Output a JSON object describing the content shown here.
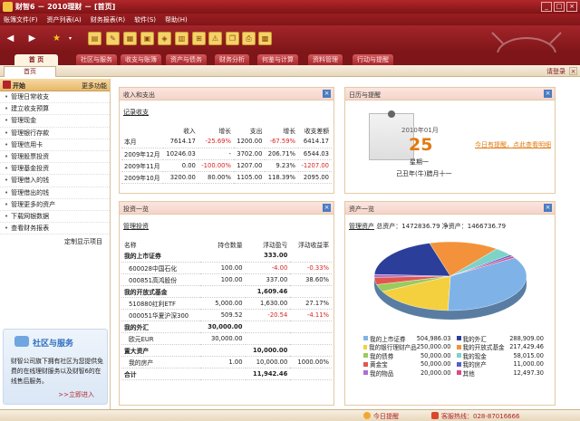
{
  "window": {
    "title": "财智6 － 2010理财 － [首页]",
    "buttons": [
      "_",
      "□",
      "×"
    ]
  },
  "menu": [
    "账簿文件(F)",
    "资产列表(A)",
    "财务报表(R)",
    "软件(S)",
    "帮助(H)"
  ],
  "tabs": [
    "首 页",
    "社区与服务",
    "收支与账簿",
    "资产与债务",
    "财务分析",
    "何鉴与计算",
    "资料管理",
    "行动与提醒"
  ],
  "subbar": {
    "tab": "首页",
    "right": "请登录",
    "close": "×"
  },
  "sidebar": {
    "head": "开始",
    "more": "更多功能",
    "items": [
      "管理日常收支",
      "建立收支预算",
      "管理现金",
      "管理银行存款",
      "管理信用卡",
      "管理股票投资",
      "管理基金投资",
      "管理借入的钱",
      "管理借出的钱",
      "管理更多的资产",
      "下载网银数据",
      "查看财务报表"
    ],
    "custom": "定制显示项目",
    "community": {
      "title": "社区与服务",
      "text": "财智公司旗下拥有社区为您提供免费的在线理财服务以及财智6的在线售后服务。",
      "link": ">>立即进入"
    }
  },
  "income": {
    "title": "收入和支出",
    "subtitle": "记录收支",
    "headers": [
      "",
      "收入",
      "增长",
      "支出",
      "增长",
      "收支差额"
    ],
    "rows": [
      [
        "本月",
        "7614.17",
        "-25.69%",
        "1200.00",
        "-67.59%",
        "6414.17"
      ],
      [
        "2009年12月",
        "10246.03",
        "-",
        "3702.00",
        "206.71%",
        "6544.03"
      ],
      [
        "2009年11月",
        "0.00",
        "-100.00%",
        "1207.00",
        "9.23%",
        "-1207.00"
      ],
      [
        "2009年10月",
        "3200.00",
        "80.00%",
        "1105.00",
        "118.39%",
        "2095.00"
      ]
    ]
  },
  "invest": {
    "title": "投资一览",
    "subtitle": "管理投资",
    "headers": [
      "名称",
      "持仓数量",
      "浮动盈亏",
      "浮动收益率"
    ],
    "rows": [
      {
        "name": "我的上市证券",
        "qty": "",
        "pl": "333.00",
        "rate": "",
        "group": true
      },
      {
        "name": "600028中国石化",
        "qty": "100.00",
        "pl": "-4.00",
        "rate": "-0.33%",
        "group": false
      },
      {
        "name": "000851高鸿股份",
        "qty": "100.00",
        "pl": "337.00",
        "rate": "38.60%",
        "group": false
      },
      {
        "name": "我的开放式基金",
        "qty": "",
        "pl": "1,609.46",
        "rate": "",
        "group": true
      },
      {
        "name": "510880红利ETF",
        "qty": "5,000.00",
        "pl": "1,630.00",
        "rate": "27.17%",
        "group": false
      },
      {
        "name": "000051华夏沪深300",
        "qty": "509.52",
        "pl": "-20.54",
        "rate": "-4.11%",
        "group": false
      },
      {
        "name": "我的外汇",
        "qty": "30,000.00",
        "pl": "",
        "rate": "",
        "group": true
      },
      {
        "name": "欧元EUR",
        "qty": "30,000.00",
        "pl": "",
        "rate": "",
        "group": false
      },
      {
        "name": "置大资产",
        "qty": "",
        "pl": "10,000.00",
        "rate": "",
        "group": true
      },
      {
        "name": "我的房产",
        "qty": "1.00",
        "pl": "10,000.00",
        "rate": "1000.00%",
        "group": false
      },
      {
        "name": "合计",
        "qty": "",
        "pl": "11,942.46",
        "rate": "",
        "group": true
      }
    ]
  },
  "calendar": {
    "title": "日历与提醒",
    "date": "2010年01月",
    "day": "25",
    "weekday": "星期一",
    "lunar": "己丑年(牛)腊月十一",
    "link": "今日有提醒，点此查看明细"
  },
  "assets": {
    "title": "资产一览",
    "subtitle": "管理资产",
    "summary": "总资产：1472836.79 净资产：1466736.79"
  },
  "chart_data": {
    "type": "pie",
    "categories": [
      "我的上市证券",
      "我的银行理财产品",
      "我的债券",
      "黄金宝",
      "我的物品",
      "我的外汇",
      "我的开放式基金",
      "我的现金",
      "我的房产",
      "其他"
    ],
    "values": [
      504986.03,
      250000.0,
      50000.0,
      50000.0,
      20000.0,
      288909.0,
      217429.46,
      58015.0,
      11000.0,
      12497.3
    ],
    "value_labels": [
      "504,986.03",
      "250,000.00",
      "50,000.00",
      "50,000.00",
      "20,000.00",
      "288,909.00",
      "217,429.46",
      "58,015.00",
      "11,000.00",
      "12,497.30"
    ],
    "colors": [
      "#7fb3e8",
      "#f4d03f",
      "#9acb5c",
      "#e1574e",
      "#b06dd1",
      "#2b3f9a",
      "#f3923b",
      "#7dd3c8",
      "#5560c9",
      "#d94a8c"
    ]
  },
  "status": {
    "reminder": "今日提醒",
    "hotline": "客服热线：028-87016666"
  }
}
